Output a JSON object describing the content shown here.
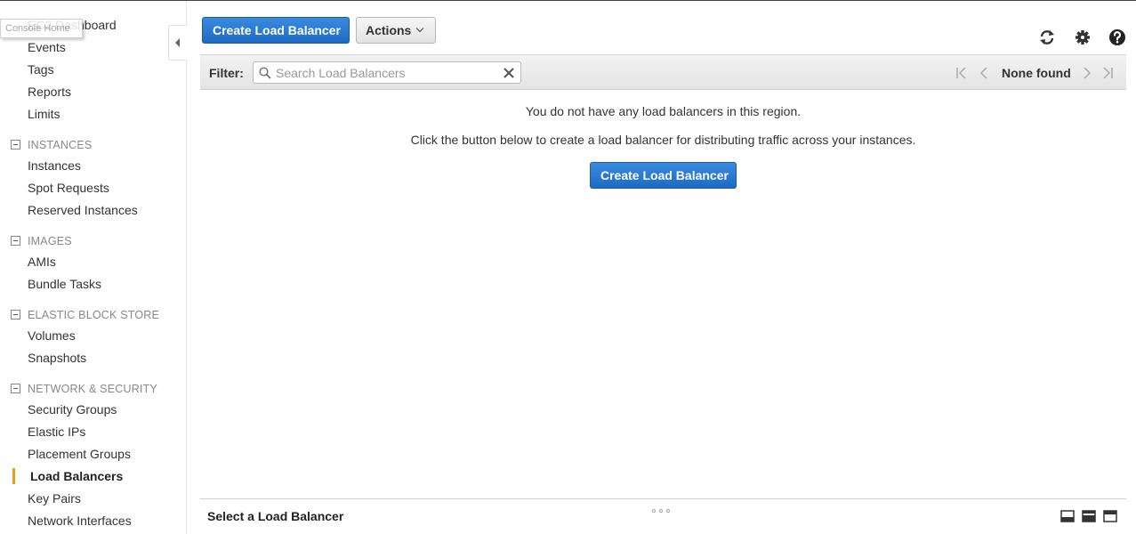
{
  "sidebar": {
    "tooltip": "Console Home",
    "top_links": [
      "EC2 Dashboard",
      "Events",
      "Tags",
      "Reports",
      "Limits"
    ],
    "sections": [
      {
        "heading": "INSTANCES",
        "items": [
          "Instances",
          "Spot Requests",
          "Reserved Instances"
        ]
      },
      {
        "heading": "IMAGES",
        "items": [
          "AMIs",
          "Bundle Tasks"
        ]
      },
      {
        "heading": "ELASTIC BLOCK STORE",
        "items": [
          "Volumes",
          "Snapshots"
        ]
      },
      {
        "heading": "NETWORK & SECURITY",
        "items": [
          "Security Groups",
          "Elastic IPs",
          "Placement Groups",
          "Load Balancers",
          "Key Pairs",
          "Network Interfaces"
        ]
      }
    ],
    "active_item": "Load Balancers",
    "active_color": "#f39a1e"
  },
  "toolbar": {
    "create_label": "Create Load Balancer",
    "actions_label": "Actions",
    "icons": [
      "refresh-icon",
      "gear-icon",
      "help-icon"
    ]
  },
  "filter": {
    "label": "Filter:",
    "placeholder": "Search Load Balancers",
    "pager_status": "None found"
  },
  "empty_state": {
    "line1": "You do not have any load balancers in this region.",
    "line2": "Click the button below to create a load balancer for distributing traffic across your instances.",
    "button_label": "Create Load Balancer"
  },
  "bottom_panel": {
    "title": "Select a Load Balancer"
  },
  "colors": {
    "primary_button": "#1d6ac2",
    "accent": "#f39a1e"
  }
}
